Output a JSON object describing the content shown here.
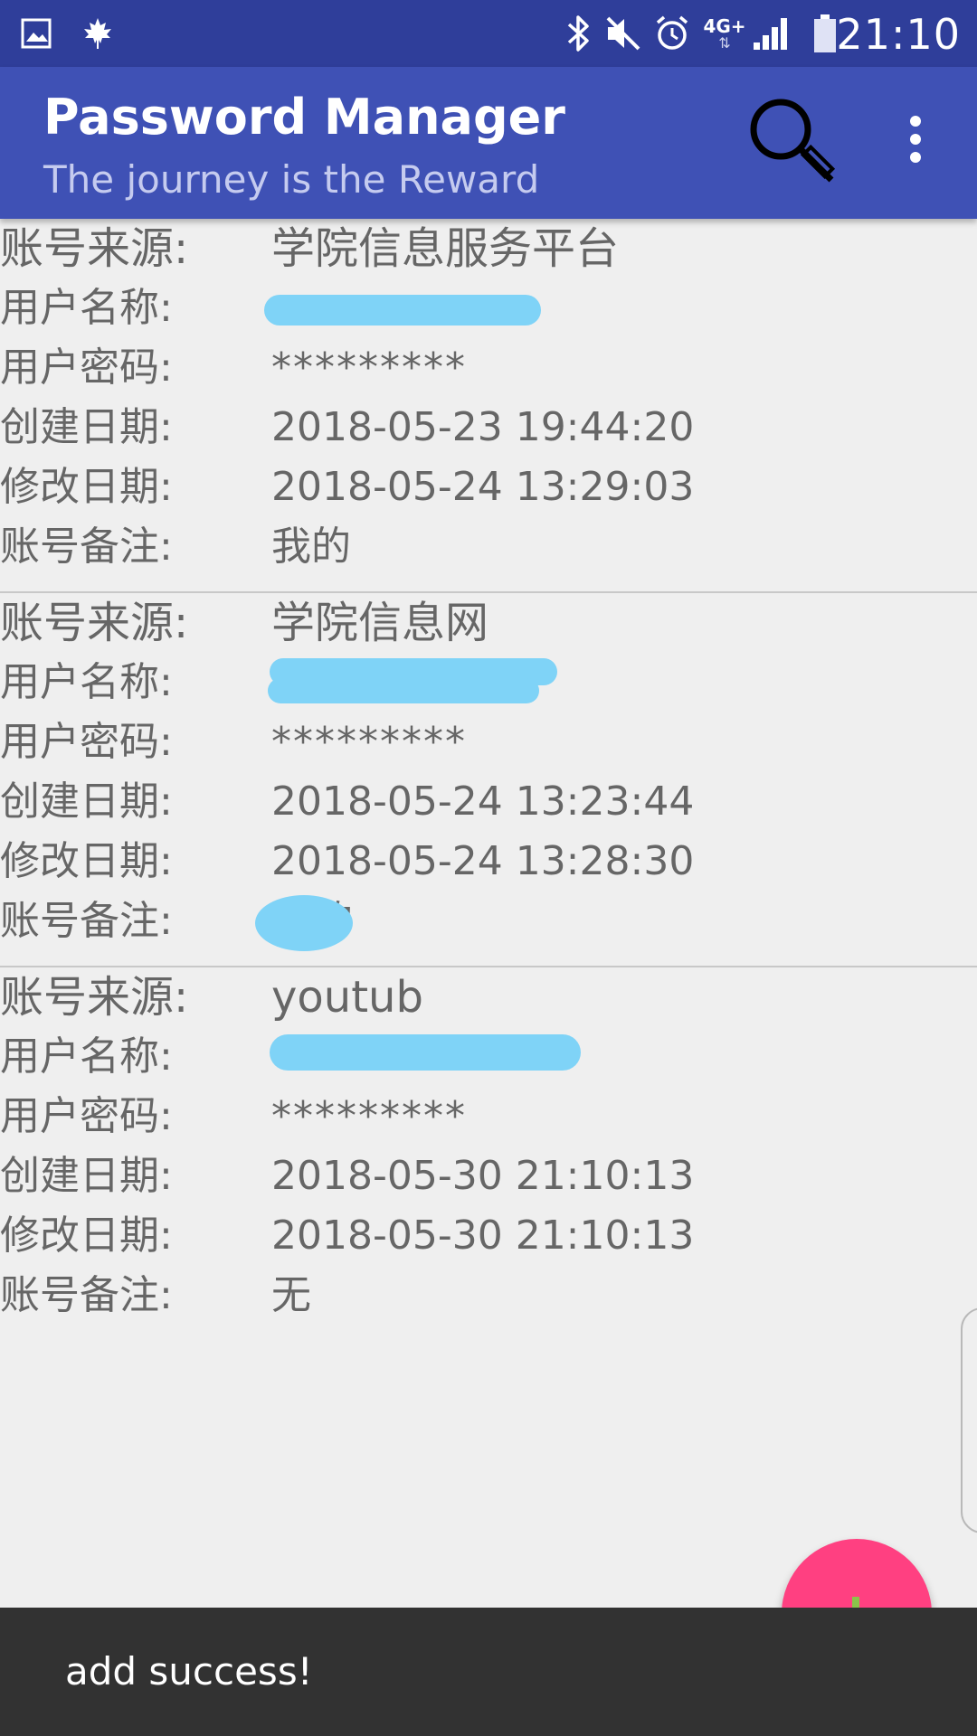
{
  "status_bar": {
    "time": "21:10",
    "network": "4G+",
    "icons": [
      "image-icon",
      "maple-leaf-icon",
      "bluetooth-icon",
      "mute-icon",
      "alarm-icon",
      "network-4g-icon",
      "signal-icon",
      "battery-icon"
    ]
  },
  "app_bar": {
    "title": "Password Manager",
    "subtitle": "The journey is the Reward",
    "actions": [
      "search-icon",
      "more-vert-icon"
    ]
  },
  "labels": {
    "source": "账号来源:",
    "username": "用户名称:",
    "password": "用户密码:",
    "created": "创建日期:",
    "modified": "修改日期:",
    "note": "账号备注:"
  },
  "records": [
    {
      "source": "学院信息服务平台",
      "username": "",
      "password": "*********",
      "created": "2018-05-23 19:44:20",
      "modified": "2018-05-24 13:29:03",
      "note": "我的"
    },
    {
      "source": "学院信息网",
      "username": "",
      "password": "*********",
      "created": "2018-05-24 13:23:44",
      "modified": "2018-05-24 13:28:30",
      "note": "的"
    },
    {
      "source": "youtub",
      "username": "",
      "password": "*********",
      "created": "2018-05-30 21:10:13",
      "modified": "2018-05-30 21:10:13",
      "note": "无"
    }
  ],
  "fab": {
    "icon": "add-icon"
  },
  "snackbar": {
    "message": "add success!"
  },
  "colors": {
    "status_bar": "#2f3e9a",
    "app_bar": "#3f51b5",
    "fab": "#ff4081",
    "snackbar": "#323232",
    "redaction": "#7fd3f7"
  }
}
